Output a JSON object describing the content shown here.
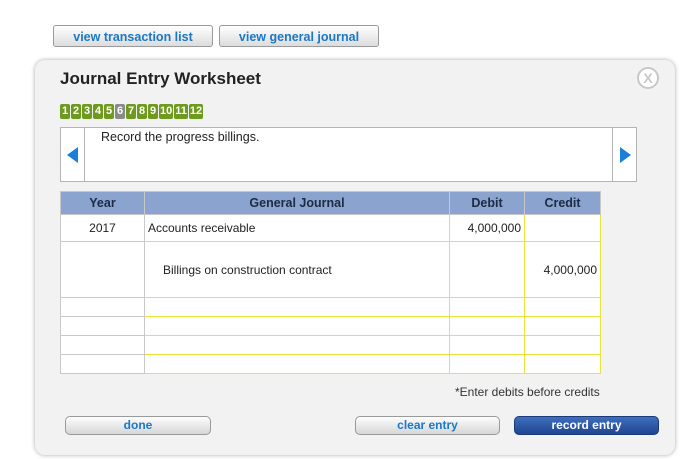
{
  "top_buttons": {
    "transactions_label": "view transaction list",
    "general_journal_label": "view general journal"
  },
  "worksheet": {
    "title": "Journal Entry Worksheet",
    "close_label": "X",
    "steps": [
      "1",
      "2",
      "3",
      "4",
      "5",
      "6",
      "7",
      "8",
      "9",
      "10",
      "11",
      "12"
    ],
    "active_step": "6",
    "instruction": "Record the progress billings."
  },
  "table": {
    "headers": {
      "year": "Year",
      "general_journal": "General Journal",
      "debit": "Debit",
      "credit": "Credit"
    },
    "rows": [
      {
        "year": "2017",
        "account": "Accounts receivable",
        "debit": "4,000,000",
        "credit": ""
      },
      {
        "year": "",
        "account": "Billings on construction contract",
        "debit": "",
        "credit": "4,000,000"
      },
      {
        "year": "",
        "account": "",
        "debit": "",
        "credit": ""
      },
      {
        "year": "",
        "account": "",
        "debit": "",
        "credit": ""
      },
      {
        "year": "",
        "account": "",
        "debit": "",
        "credit": ""
      },
      {
        "year": "",
        "account": "",
        "debit": "",
        "credit": ""
      }
    ]
  },
  "note": "*Enter debits before credits",
  "bottom_buttons": {
    "done_label": "done",
    "clear_label": "clear entry",
    "record_label": "record entry"
  },
  "colors": {
    "step_green": "#6e9a1e",
    "step_active": "#8a8a8a",
    "header_blue": "#8aa4cf",
    "cell_border_yellow": "#e8e43a",
    "link_blue": "#1a78c8",
    "record_button": "#2a56a5"
  }
}
